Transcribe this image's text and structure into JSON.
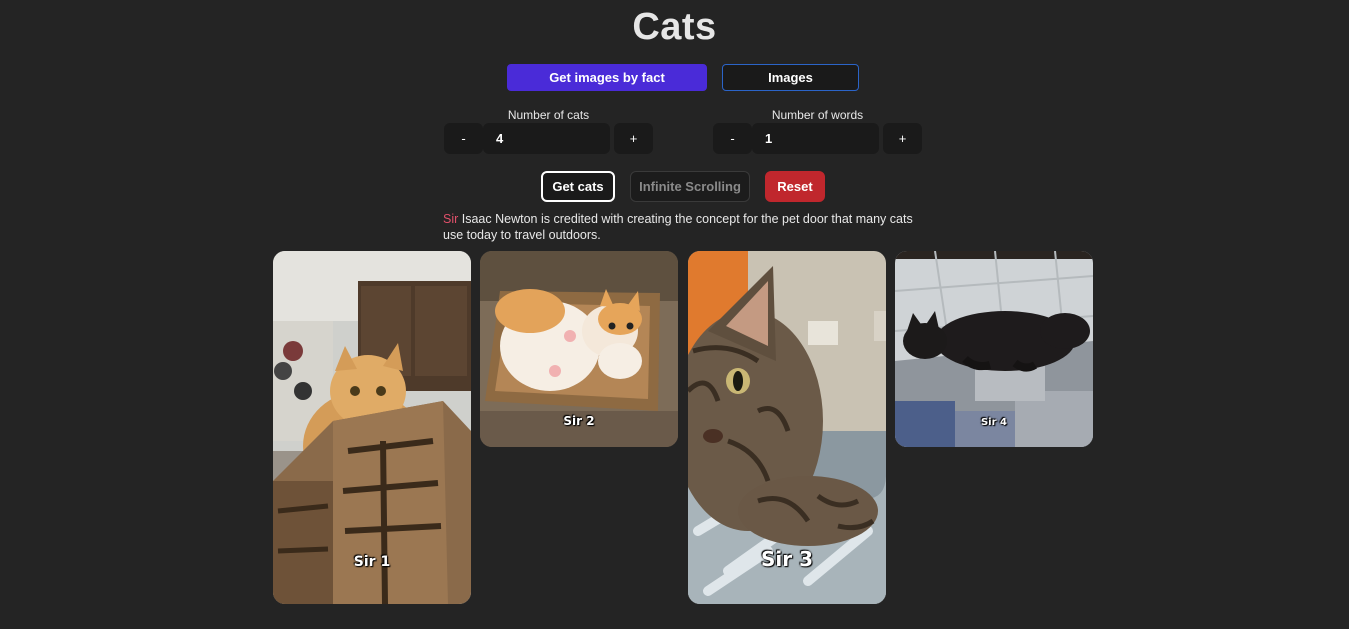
{
  "header": {
    "title": "Cats"
  },
  "tabs": {
    "by_fact": "Get images by fact",
    "images": "Images"
  },
  "cats_count": {
    "label": "Number of cats",
    "minus": "-",
    "value": "4",
    "plus": "+"
  },
  "words_count": {
    "label": "Number of words",
    "minus": "-",
    "value": "1",
    "plus": "+"
  },
  "actions": {
    "get_cats": "Get cats",
    "infinite": "Infinite Scrolling",
    "reset": "Reset"
  },
  "fact": {
    "highlight": "Sir",
    "rest": " Isaac Newton is credited with creating the concept for the pet door that many cats use today to travel outdoors."
  },
  "cards": [
    {
      "caption": "Sir 1",
      "icon": "orange-cat-in-box-photo"
    },
    {
      "caption": "Sir 2",
      "icon": "cat-in-cardboard-box-photo"
    },
    {
      "caption": "Sir 3",
      "icon": "tabby-cat-photo"
    },
    {
      "caption": "Sir 4",
      "icon": "black-cat-on-carpet-photo"
    }
  ],
  "colors": {
    "background": "#242424",
    "primary": "#4a2bd8",
    "outline_blue": "#2b64c8",
    "reset_red": "#c0272d",
    "highlight_pink": "#e0506a"
  }
}
